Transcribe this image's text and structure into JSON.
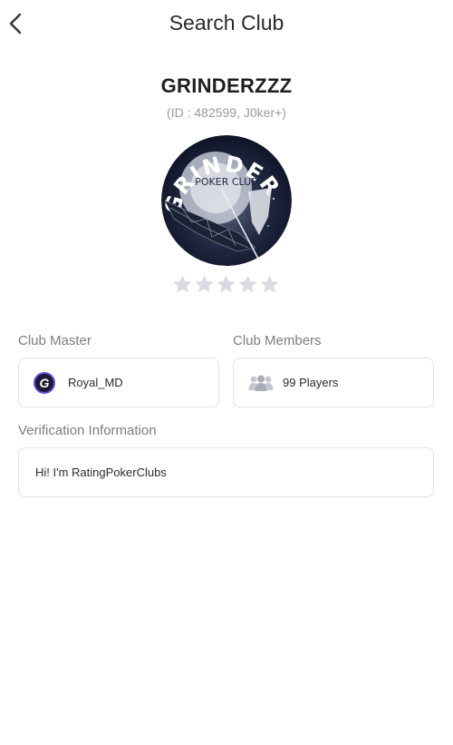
{
  "header": {
    "title": "Search Club",
    "back_icon": "chevron-left-icon"
  },
  "club": {
    "name": "GRINDERZZZ",
    "id_line": "(ID : 482599, J0ker+)",
    "logo": {
      "line1": "GRINDERZ",
      "line2": "POKER CLUB",
      "icon": "shark-logo"
    },
    "rating": {
      "value": 0,
      "max": 5
    }
  },
  "master": {
    "label": "Club Master",
    "avatar_letter": "G",
    "name": "Royal_MD"
  },
  "members": {
    "label": "Club Members",
    "icon": "people-icon",
    "count_text": "99 Players"
  },
  "verification": {
    "label": "Verification Information",
    "text": "Hi! I'm RatingPokerClubs"
  },
  "colors": {
    "star_empty": "#d9dbe0",
    "border": "#e3e3e3",
    "label": "#7d7d7d",
    "logo_bg": "#111827"
  }
}
